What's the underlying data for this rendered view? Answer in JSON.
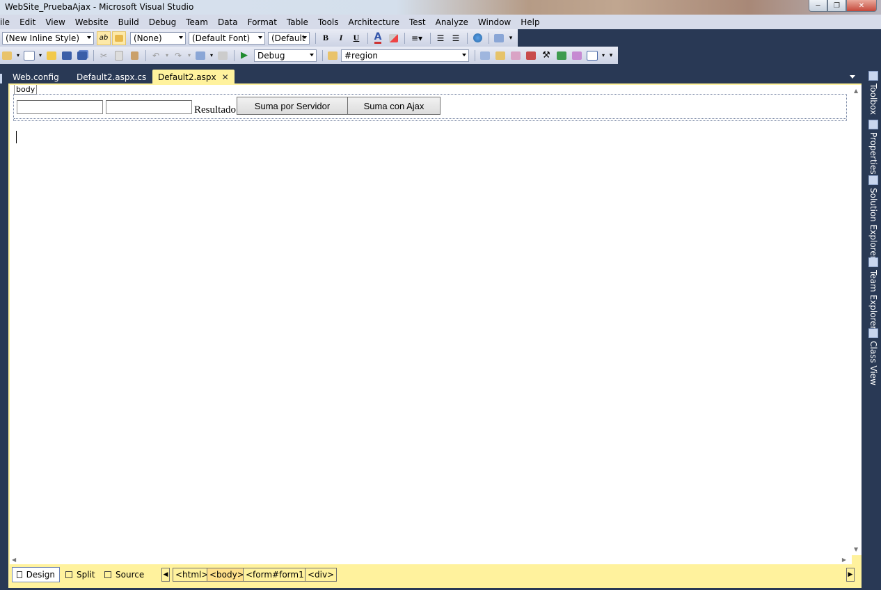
{
  "window": {
    "title": "WebSite_PruebaAjax - Microsoft Visual Studio"
  },
  "menu": [
    "ile",
    "Edit",
    "View",
    "Website",
    "Build",
    "Debug",
    "Team",
    "Data",
    "Format",
    "Table",
    "Tools",
    "Architecture",
    "Test",
    "Analyze",
    "Window",
    "Help"
  ],
  "toolbar1": {
    "style_combo": "(New Inline Style)",
    "block_combo": "(None)",
    "font_combo": "(Default Font)",
    "size_combo": "(Default",
    "bold": "B",
    "italic": "I",
    "underline": "U"
  },
  "toolbar2": {
    "config_combo": "Debug",
    "find_combo": "#region"
  },
  "tabs": [
    {
      "label": "Web.config"
    },
    {
      "label": "Default2.aspx.cs"
    },
    {
      "label": "Default2.aspx",
      "active": true
    }
  ],
  "dock": [
    "Toolbox",
    "Properties",
    "Solution Explorer",
    "Team Explorer",
    "Class View"
  ],
  "design": {
    "body_tag": "body",
    "label": "Resultado",
    "button_server": "Suma por Servidor",
    "button_ajax": "Suma con Ajax"
  },
  "viewmodes": {
    "design": "Design",
    "split": "Split",
    "source": "Source"
  },
  "breadcrumbs": [
    "<html>",
    "<body>",
    "<form#form1>",
    "<div>"
  ],
  "colors": {
    "chrome": "#293955",
    "accent": "#fff29d",
    "menu": "#d6dbe9"
  }
}
